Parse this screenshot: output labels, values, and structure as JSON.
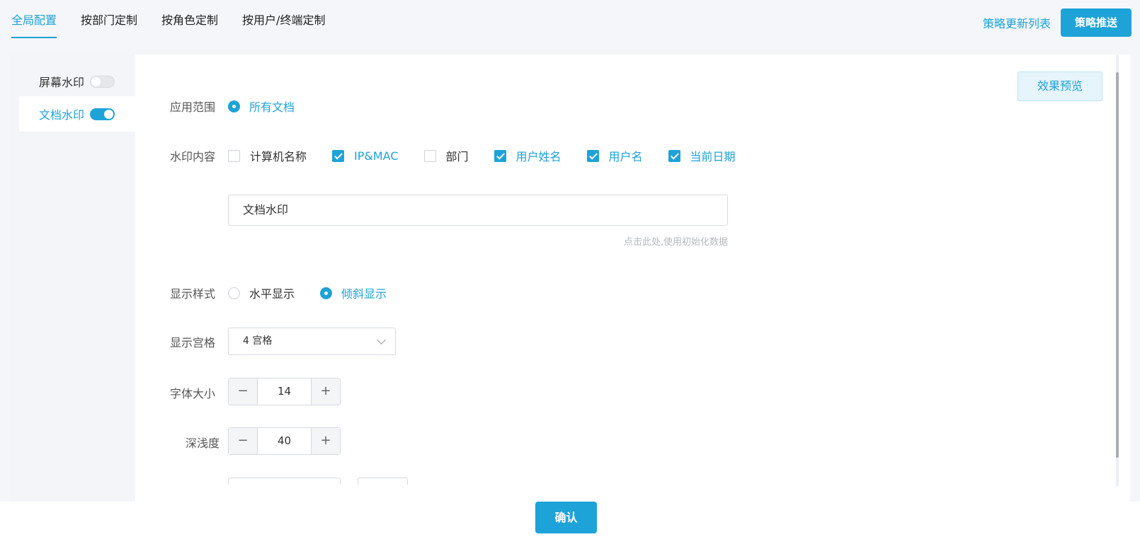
{
  "tabs": [
    {
      "label": "全局配置",
      "active": true
    },
    {
      "label": "按部门定制",
      "active": false
    },
    {
      "label": "按角色定制",
      "active": false
    },
    {
      "label": "按用户/终端定制",
      "active": false
    }
  ],
  "header": {
    "policy_list_label": "策略更新列表",
    "push_label": "策略推送"
  },
  "sidebar": {
    "items": [
      {
        "label": "屏幕水印",
        "enabled": false
      },
      {
        "label": "文档水印",
        "enabled": true
      }
    ]
  },
  "preview_label": "效果预览",
  "form": {
    "scope": {
      "label": "应用范围",
      "option": "所有文档"
    },
    "content": {
      "label": "水印内容",
      "options": [
        {
          "label": "计算机名称",
          "checked": false
        },
        {
          "label": "IP&MAC",
          "checked": true
        },
        {
          "label": "部门",
          "checked": false
        },
        {
          "label": "用户姓名",
          "checked": true
        },
        {
          "label": "用户名",
          "checked": true
        },
        {
          "label": "当前日期",
          "checked": true
        }
      ],
      "text_value": "文档水印",
      "hint": "点击此处,使用初始化数据"
    },
    "style": {
      "label": "显示样式",
      "options": [
        {
          "label": "水平显示",
          "selected": false
        },
        {
          "label": "倾斜显示",
          "selected": true
        }
      ]
    },
    "grid": {
      "label": "显示宫格",
      "value": "4 宫格"
    },
    "font_size": {
      "label": "字体大小",
      "value": "14"
    },
    "opacity": {
      "label": "深浅度",
      "value": "40"
    },
    "minus": "−",
    "plus": "+"
  },
  "confirm_label": "确认",
  "colors": {
    "accent": "#1ea3d8"
  }
}
